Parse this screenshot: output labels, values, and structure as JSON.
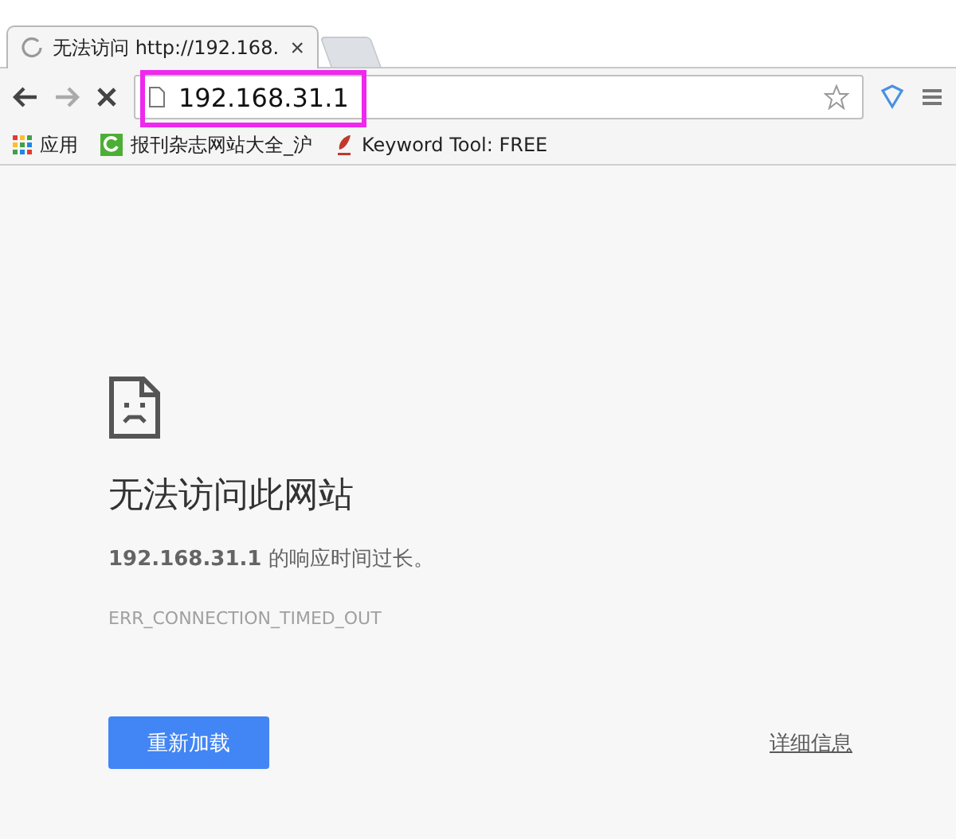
{
  "tab": {
    "title": "无法访问 http://192.168.",
    "loading": true,
    "close": "×"
  },
  "address_bar": {
    "value": "192.168.31.1",
    "highlighted": true
  },
  "bookmarks": [
    {
      "label": "应用",
      "kind": "apps"
    },
    {
      "label": "报刊杂志网站大全_沪",
      "kind": "green"
    },
    {
      "label": "Keyword Tool: FREE",
      "kind": "quill"
    }
  ],
  "error": {
    "title": "无法访问此网站",
    "message": "**192.168.31.1** 的响应时间过长。",
    "code": "ERR_CONNECTION_TIMED_OUT",
    "reload_button": "重新加载",
    "details_link": "详细信息"
  }
}
